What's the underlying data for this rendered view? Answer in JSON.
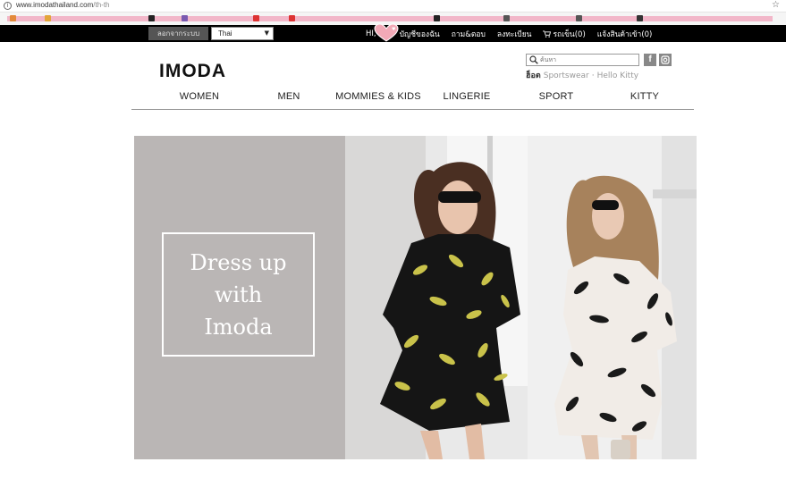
{
  "browser": {
    "url_host": "www.imodathailand.com",
    "url_path": "/th-th"
  },
  "topbar": {
    "logout_label": "ลอกจากระบบ",
    "language": "Thai",
    "greeting": "HI,",
    "links": [
      {
        "label": "บัญชีของฉัน"
      },
      {
        "label": "ถาม&ตอบ"
      },
      {
        "label": "ลงทะเบียน"
      }
    ],
    "cart_label": "รถเข็น(0)",
    "notify_label": "แจ้งสินค้าเข้า(0)"
  },
  "header": {
    "logo": "IMODA",
    "search_placeholder": "ค้นหา",
    "hot_label": "ฮ็อต",
    "hot_terms": [
      "Sportswear",
      "Hello Kitty"
    ],
    "hot_separator": "·"
  },
  "nav": [
    {
      "label": "WOMEN"
    },
    {
      "label": "MEN"
    },
    {
      "label": "MOMMIES & KIDS"
    },
    {
      "label": "LINGERIE"
    },
    {
      "label": "SPORT"
    },
    {
      "label": "KITTY"
    }
  ],
  "hero": {
    "headline": "Dress up\nwith\nImoda"
  },
  "colors": {
    "topbar_bg": "#000000",
    "hero_bg": "#bab6b5",
    "bookmark_strip": "#f2b7c9"
  }
}
